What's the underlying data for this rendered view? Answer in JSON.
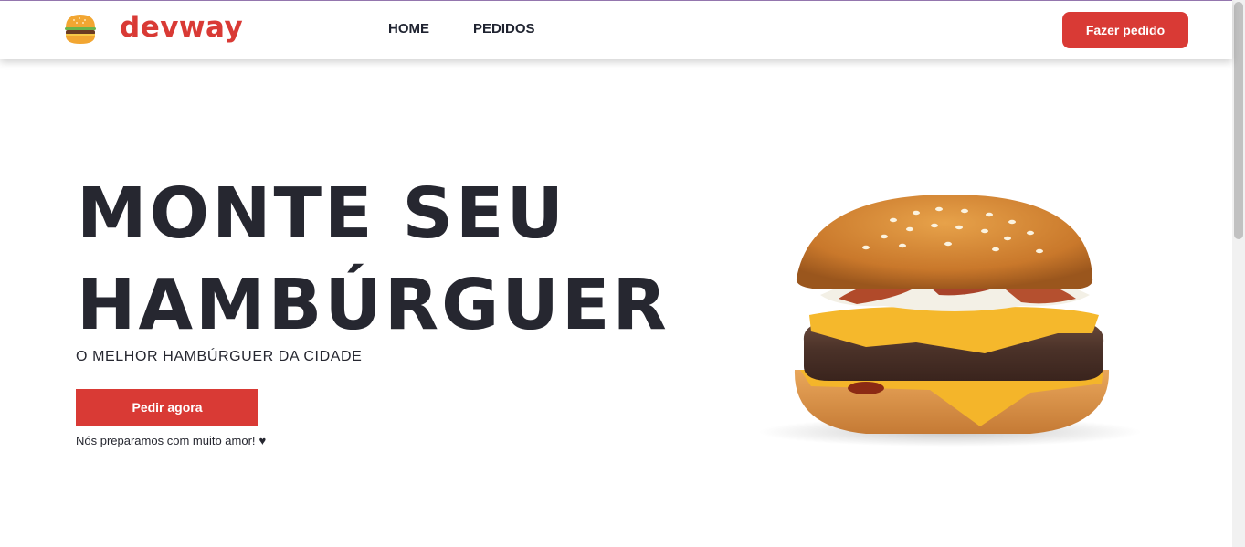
{
  "header": {
    "brand": "devway",
    "nav": [
      {
        "label": "HOME"
      },
      {
        "label": "PEDIDOS"
      }
    ],
    "order_button": "Fazer pedido"
  },
  "hero": {
    "title_line1": "MONTE SEU",
    "title_line2": "HAMBÚRGUER",
    "subtitle": "O MELHOR HAMBÚRGUER DA CIDADE",
    "cta": "Pedir agora",
    "note": "Nós preparamos com muito amor!",
    "note_icon": "heart-icon"
  },
  "colors": {
    "accent": "#d93a35",
    "text": "#262730",
    "background": "#ffffff"
  }
}
